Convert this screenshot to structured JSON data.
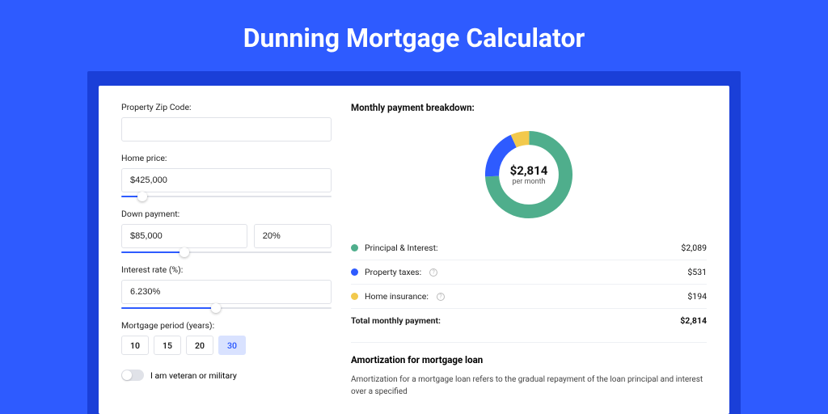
{
  "page": {
    "title": "Dunning Mortgage Calculator"
  },
  "form": {
    "zip_label": "Property Zip Code:",
    "zip_value": "",
    "home_price_label": "Home price:",
    "home_price_value": "$425,000",
    "down_payment_label": "Down payment:",
    "down_payment_value": "$85,000",
    "down_payment_pct": "20%",
    "interest_label": "Interest rate (%):",
    "interest_value": "6.230%",
    "period_label": "Mortgage period (years):",
    "periods": [
      "10",
      "15",
      "20",
      "30"
    ],
    "active_period_index": 3,
    "veteran_label": "I am veteran or military"
  },
  "chart_data": {
    "type": "pie",
    "title": "Monthly payment breakdown:",
    "center_value": "$2,814",
    "center_sub": "per month",
    "series": [
      {
        "name": "Principal & Interest:",
        "value": 2089,
        "display": "$2,089",
        "color": "#4fae8c"
      },
      {
        "name": "Property taxes:",
        "value": 531,
        "display": "$531",
        "color": "#2e5bff"
      },
      {
        "name": "Home insurance:",
        "value": 194,
        "display": "$194",
        "color": "#f2c94c"
      }
    ],
    "total_label": "Total monthly payment:",
    "total_value": "$2,814"
  },
  "amort": {
    "title": "Amortization for mortgage loan",
    "text": "Amortization for a mortgage loan refers to the gradual repayment of the loan principal and interest over a specified"
  }
}
